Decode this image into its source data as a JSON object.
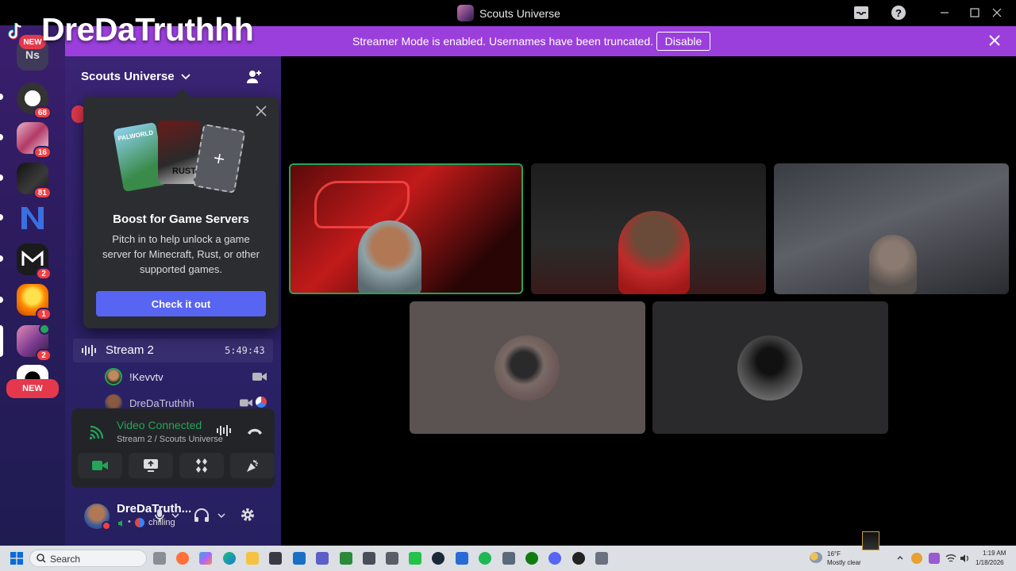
{
  "window": {
    "title": "Scouts Universe"
  },
  "overlay": {
    "streamer_name": "DreDaTruthhh",
    "new_tag": "NEW"
  },
  "banner": {
    "message": "Streamer Mode is enabled. Usernames have been truncated.",
    "disable_label": "Disable"
  },
  "rail": {
    "top_initials": "Ns",
    "servers": [
      {
        "badge": "68"
      },
      {
        "badge": "16"
      },
      {
        "badge": "81"
      },
      {
        "badge": ""
      },
      {
        "badge": "2"
      },
      {
        "badge": "1"
      },
      {
        "badge": "2"
      },
      {
        "badge": ""
      }
    ],
    "new_label": "NEW"
  },
  "sidebar": {
    "server_name": "Scouts Universe"
  },
  "popup": {
    "heading": "Boost for Game Servers",
    "body": "Pitch in to help unlock a game server for Minecraft, Rust, or other supported games.",
    "cta": "Check it out",
    "card_texts": [
      "PALWORLD",
      "RUST"
    ]
  },
  "voice_channel": {
    "name": "Stream 2",
    "duration": "5:49:43",
    "members": [
      {
        "name": "!Kevvtv"
      },
      {
        "name": "DreDaTruthhh"
      }
    ]
  },
  "voice_panel": {
    "status": "Video Connected",
    "location": "Stream 2 / Scouts Universe"
  },
  "user": {
    "display_name": "DreDaTruth...",
    "status": "chilling"
  },
  "taskbar": {
    "search_placeholder": "Search",
    "weather_temp": "16°F",
    "weather_desc": "Mostly clear",
    "time": "1:19 AM",
    "date": "1/18/2026"
  },
  "colors": {
    "banner": "#9b3fdc",
    "accent": "#5865f2",
    "speaking": "#3ba55d",
    "badge": "#f23f42"
  }
}
